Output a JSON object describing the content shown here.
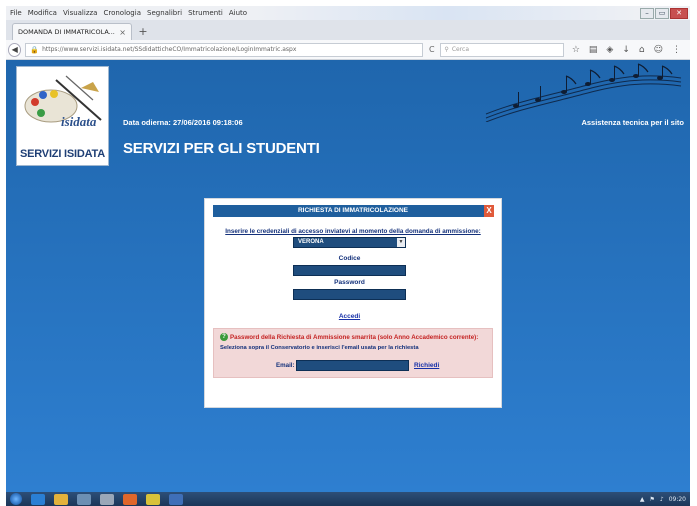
{
  "menubar": {
    "items": [
      "File",
      "Modifica",
      "Visualizza",
      "Cronologia",
      "Segnalibri",
      "Strumenti",
      "Aiuto"
    ],
    "window_controls": [
      "–",
      "▭",
      "✕"
    ]
  },
  "tab": {
    "title": "DOMANDA DI IMMATRICOLA...",
    "close": "×",
    "new_tab": "+"
  },
  "navbar": {
    "url": "https://www.servizi.isidata.net/SSdidatticheCO/Immatricolazione/LoginImmatric.aspx",
    "search_placeholder": "Cerca"
  },
  "header": {
    "logo_caption": "SERVIZI ISIDATA",
    "date_line": "Data odierna: 27/06/2016 09:18:06",
    "support_link": "Assistenza tecnica per il sito",
    "page_heading": "SERVIZI PER GLI STUDENTI"
  },
  "modal": {
    "title": "RICHIESTA DI IMMATRICOLAZIONE",
    "close": "X",
    "instructions": "Inserire le credenziali di accesso inviatevi al momento della domanda di ammissione:",
    "conservatory_select": "VERONA",
    "code_label": "Codice",
    "password_label": "Password",
    "login_link": "Accedi",
    "recover": {
      "title": "Password della Richiesta di Ammissione smarrita (solo Anno Accademico corrente):",
      "instructions": "Seleziona sopra il Conservatorio e inserisci l'email usata per la richiesta",
      "email_label": "Email:",
      "request_link": "Richiedi"
    }
  },
  "taskbar": {
    "tray_clock": "09:20"
  },
  "colors": {
    "page_background": "#2472c0",
    "modal_header": "#1f5f9e",
    "input_fill": "#1f4d7e",
    "recover_panel": "#f2d8d8",
    "recover_title": "#c42222",
    "link": "#1730a8"
  }
}
